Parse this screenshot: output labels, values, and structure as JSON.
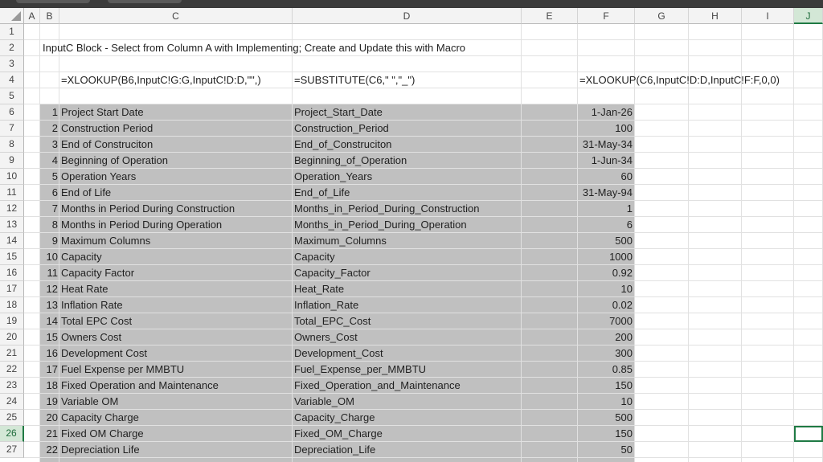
{
  "columns": [
    "A",
    "B",
    "C",
    "D",
    "E",
    "F",
    "G",
    "H",
    "I",
    "J"
  ],
  "selected_column": "J",
  "selected_row": "26",
  "rows": [
    "1",
    "2",
    "3",
    "4",
    "5",
    "6",
    "7",
    "8",
    "9",
    "10",
    "11",
    "12",
    "13",
    "14",
    "15",
    "16",
    "17",
    "18",
    "19",
    "20",
    "21",
    "22",
    "23",
    "24",
    "25",
    "26",
    "27"
  ],
  "sheet": {
    "title": "InputC Block - Select from Column A with Implementing; Create and Update this with Macro",
    "formula_c": "=XLOOKUP(B6,InputC!G:G,InputC!D:D,\"\",)",
    "formula_d": "=SUBSTITUTE(C6,\" \",\"_\")",
    "formula_f": "=XLOOKUP(C6,InputC!D:D,InputC!F:F,0,0)"
  },
  "table": [
    {
      "idx": "1",
      "name": "Project Start Date",
      "key": "Project_Start_Date",
      "value": "1-Jan-26"
    },
    {
      "idx": "2",
      "name": "Construction Period",
      "key": "Construction_Period",
      "value": "100"
    },
    {
      "idx": "3",
      "name": "End of Construciton",
      "key": "End_of_Construciton",
      "value": "31-May-34"
    },
    {
      "idx": "4",
      "name": "Beginning of Operation",
      "key": "Beginning_of_Operation",
      "value": "1-Jun-34"
    },
    {
      "idx": "5",
      "name": "Operation Years",
      "key": "Operation_Years",
      "value": "60"
    },
    {
      "idx": "6",
      "name": "End of Life",
      "key": "End_of_Life",
      "value": "31-May-94"
    },
    {
      "idx": "7",
      "name": "Months in Period During Construction",
      "key": "Months_in_Period_During_Construction",
      "value": "1"
    },
    {
      "idx": "8",
      "name": "Months in Period During Operation",
      "key": "Months_in_Period_During_Operation",
      "value": "6"
    },
    {
      "idx": "9",
      "name": "Maximum Columns",
      "key": "Maximum_Columns",
      "value": "500"
    },
    {
      "idx": "10",
      "name": "Capacity",
      "key": "Capacity",
      "value": "1000"
    },
    {
      "idx": "11",
      "name": "Capacity Factor",
      "key": "Capacity_Factor",
      "value": "0.92"
    },
    {
      "idx": "12",
      "name": "Heat Rate",
      "key": "Heat_Rate",
      "value": "10"
    },
    {
      "idx": "13",
      "name": "Inflation Rate",
      "key": "Inflation_Rate",
      "value": "0.02"
    },
    {
      "idx": "14",
      "name": "Total EPC Cost",
      "key": "Total_EPC_Cost",
      "value": "7000"
    },
    {
      "idx": "15",
      "name": "Owners Cost",
      "key": "Owners_Cost",
      "value": "200"
    },
    {
      "idx": "16",
      "name": "Development Cost",
      "key": "Development_Cost",
      "value": "300"
    },
    {
      "idx": "17",
      "name": "Fuel Expense per MMBTU",
      "key": "Fuel_Expense_per_MMBTU",
      "value": "0.85"
    },
    {
      "idx": "18",
      "name": "Fixed Operation and Maintenance",
      "key": "Fixed_Operation_and_Maintenance",
      "value": "150"
    },
    {
      "idx": "19",
      "name": "Variable OM",
      "key": "Variable_OM",
      "value": "10"
    },
    {
      "idx": "20",
      "name": "Capacity Charge",
      "key": "Capacity_Charge",
      "value": "500"
    },
    {
      "idx": "21",
      "name": "Fixed OM Charge",
      "key": "Fixed_OM_Charge",
      "value": "150"
    },
    {
      "idx": "22",
      "name": "Depreciation Life",
      "key": "Depreciation_Life",
      "value": "50"
    }
  ],
  "colors": {
    "shade": "#c0c0c0",
    "selection": "#1f7a44",
    "header_bg": "#f3f3f3"
  }
}
